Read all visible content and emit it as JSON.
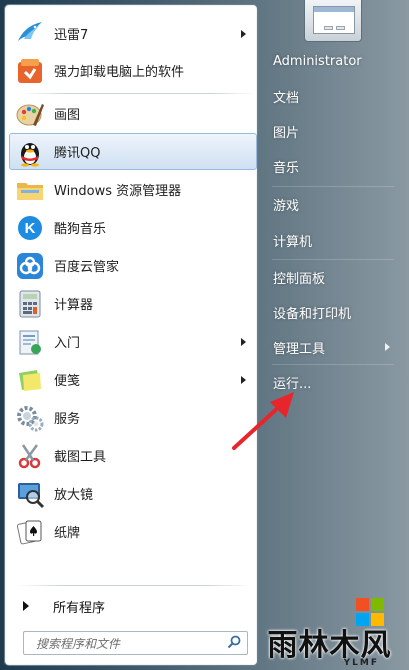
{
  "programs": [
    {
      "label": "迅雷7",
      "icon": "xunlei-bird-icon",
      "submenu": true
    },
    {
      "label": "强力卸载电脑上的软件",
      "icon": "uninstall-box-icon",
      "submenu": false
    },
    {
      "label": "画图",
      "icon": "paint-palette-icon",
      "submenu": false
    },
    {
      "label": "腾讯QQ",
      "icon": "qq-penguin-icon",
      "submenu": false,
      "highlighted": true
    },
    {
      "label": "Windows 资源管理器",
      "icon": "folder-explorer-icon",
      "submenu": false
    },
    {
      "label": "酷狗音乐",
      "icon": "kugou-k-icon",
      "submenu": false
    },
    {
      "label": "百度云管家",
      "icon": "baidu-cloud-icon",
      "submenu": false
    },
    {
      "label": "计算器",
      "icon": "calculator-icon",
      "submenu": false
    },
    {
      "label": "入门",
      "icon": "getting-started-icon",
      "submenu": true
    },
    {
      "label": "便笺",
      "icon": "sticky-notes-icon",
      "submenu": true
    },
    {
      "label": "服务",
      "icon": "services-gear-icon",
      "submenu": false
    },
    {
      "label": "截图工具",
      "icon": "snipping-scissors-icon",
      "submenu": false
    },
    {
      "label": "放大镜",
      "icon": "magnifier-icon",
      "submenu": false
    },
    {
      "label": "纸牌",
      "icon": "solitaire-cards-icon",
      "submenu": false
    }
  ],
  "all_programs_label": "所有程序",
  "search": {
    "placeholder": "搜索程序和文件",
    "icon": "search-icon"
  },
  "right_menu": [
    {
      "label": "Administrator",
      "submenu": false
    },
    {
      "label": "文档",
      "submenu": false
    },
    {
      "label": "图片",
      "submenu": false
    },
    {
      "label": "音乐",
      "submenu": false
    },
    {
      "label": "游戏",
      "submenu": false
    },
    {
      "label": "计算机",
      "submenu": false
    },
    {
      "label": "控制面板",
      "submenu": false
    },
    {
      "label": "设备和打印机",
      "submenu": false
    },
    {
      "label": "管理工具",
      "submenu": true
    },
    {
      "label": "运行...",
      "submenu": false
    }
  ],
  "colors": {
    "highlight": "#cfe0f2",
    "annotation_arrow": "#e8252a"
  },
  "watermark": {
    "main": "雨林木风",
    "sub": "YLMF"
  }
}
